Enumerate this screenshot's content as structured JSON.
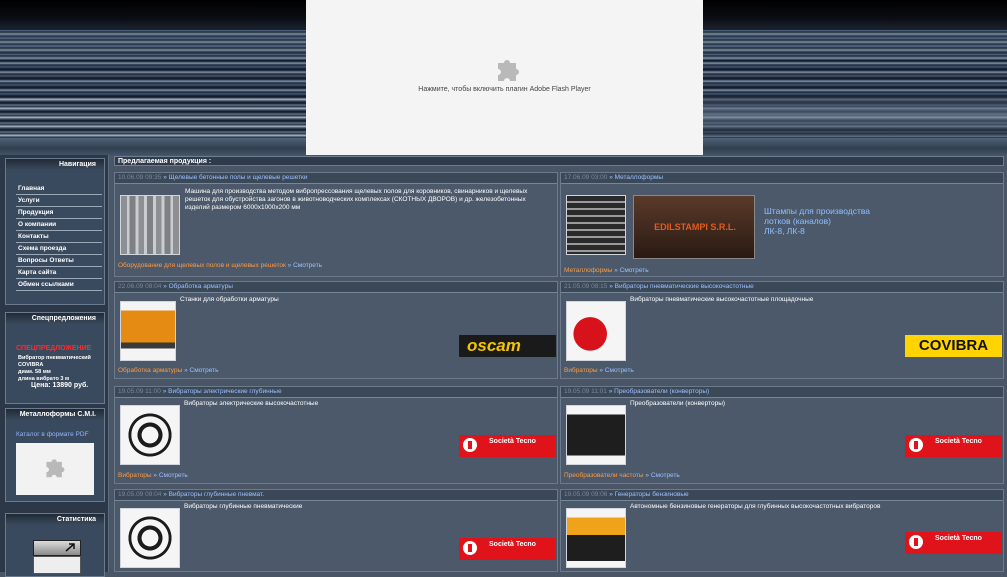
{
  "flash": {
    "message": "Нажмите, чтобы включить плагин Adobe Flash Player"
  },
  "nav": {
    "title": "Навигация",
    "items": [
      "Главная",
      "Услуги",
      "Продукция",
      "О компании",
      "Контакты",
      "Схема проезда",
      "Вопросы Ответы",
      "Карта сайта",
      "Обмен ссылками"
    ]
  },
  "offer": {
    "title": "Спецпредложения",
    "heading": "СПЕЦПРЕДЛОЖЕНИЕ",
    "lines": [
      "Вибратор пневматический",
      "COVIBRA",
      "диам. 58 мм",
      "длина вибрато 3 м"
    ],
    "price": "Цена: 13890 руб."
  },
  "catalog": {
    "title": "Металлоформы C.M.I.",
    "link": "Каталог в формате PDF"
  },
  "stats": {
    "title": "Статистика"
  },
  "main": {
    "title": "Предлагаемая продукция :",
    "more": "Смотреть",
    "cells": [
      {
        "date": "10.06.09 09:35",
        "head": "Щелевые бетонные полы и щелевые решетки",
        "text": "Машина для производства методом вибропрессования щелевых полов для коровников, свинарников и щелевых решеток для обустройства загонов в животноводческих комплексах (СКОТНЫХ ДВОРОВ) и др. железобетонных изделий размером 6000х1000х200 мм",
        "category": "Оборудование для щелевых полов и щелевых решеток"
      },
      {
        "date": "17.06.09 03:00",
        "head": "Металлоформы",
        "big": [
          "Штампы для производства",
          "лотков (каналов)",
          "ЛК-8, ЛК-8"
        ],
        "logo": "EDILSTAMPI S.R.L.",
        "category": "Металлоформы"
      },
      {
        "date": "22.06.09 08:04",
        "head": "Обработка арматуры",
        "text": "Станки для обработки арматуры",
        "logo": "oscam",
        "category": "Обработка арматуры"
      },
      {
        "date": "21.05.09 08:15",
        "head": "Вибраторы пневматические высокочастотные",
        "text": "Вибраторы пневматические высокочастотные площадочные",
        "logo": "COVIBRA",
        "category": "Вибраторы"
      },
      {
        "date": "19.05.09 11:00",
        "head": "Вибраторы электрические глубинные",
        "text": "Вибраторы электрические высокочастотные",
        "logo": "Società Tecno",
        "category": "Вибраторы"
      },
      {
        "date": "19.05.09 11:01",
        "head": "Преобразователи (конверторы)",
        "text": "Преобразователи (конверторы)",
        "logo": "Società Tecno",
        "category": "Преобразователи частоты"
      },
      {
        "date": "19.05.09 09:04",
        "head": "Вибраторы глубинные пневмат.",
        "text": "Вибраторы глубинные пневматические",
        "logo": "Società Tecno",
        "category": "Вибраторы"
      },
      {
        "date": "19.05.09 09:06",
        "head": "Генераторы бензиновые",
        "text": "Автономные бензиновые генераторы для глубинных высокочастотных вибраторов",
        "logo": "Società Tecno",
        "category": "Генераторы"
      }
    ]
  },
  "colors": {
    "accent_link": "#9cc0ff",
    "category": "#ff9a3c",
    "offer": "#ff2a2a",
    "panel": "#3a4a5e"
  }
}
